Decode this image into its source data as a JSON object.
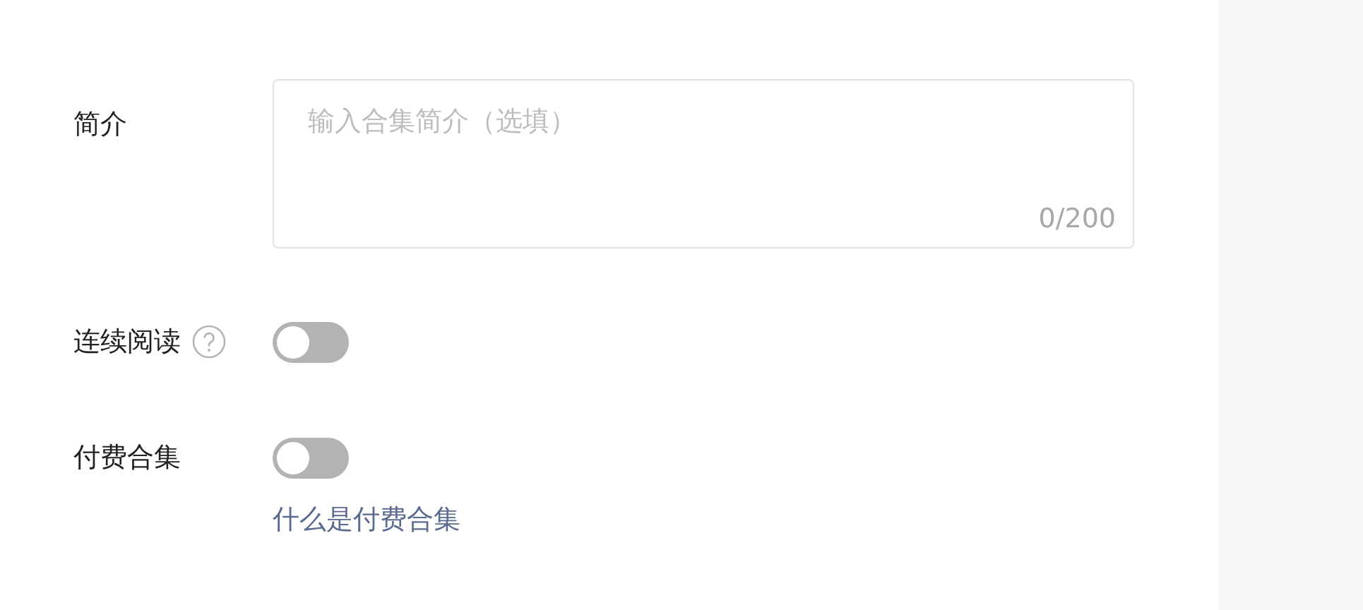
{
  "form": {
    "intro": {
      "label": "简介",
      "placeholder": "输入合集简介（选填）",
      "counter": "0/200"
    },
    "toggles": [
      {
        "label": "连续阅读",
        "help": true,
        "on": false
      },
      {
        "label": "付费合集",
        "help": false,
        "on": false,
        "link": "什么是付费合集"
      }
    ]
  }
}
